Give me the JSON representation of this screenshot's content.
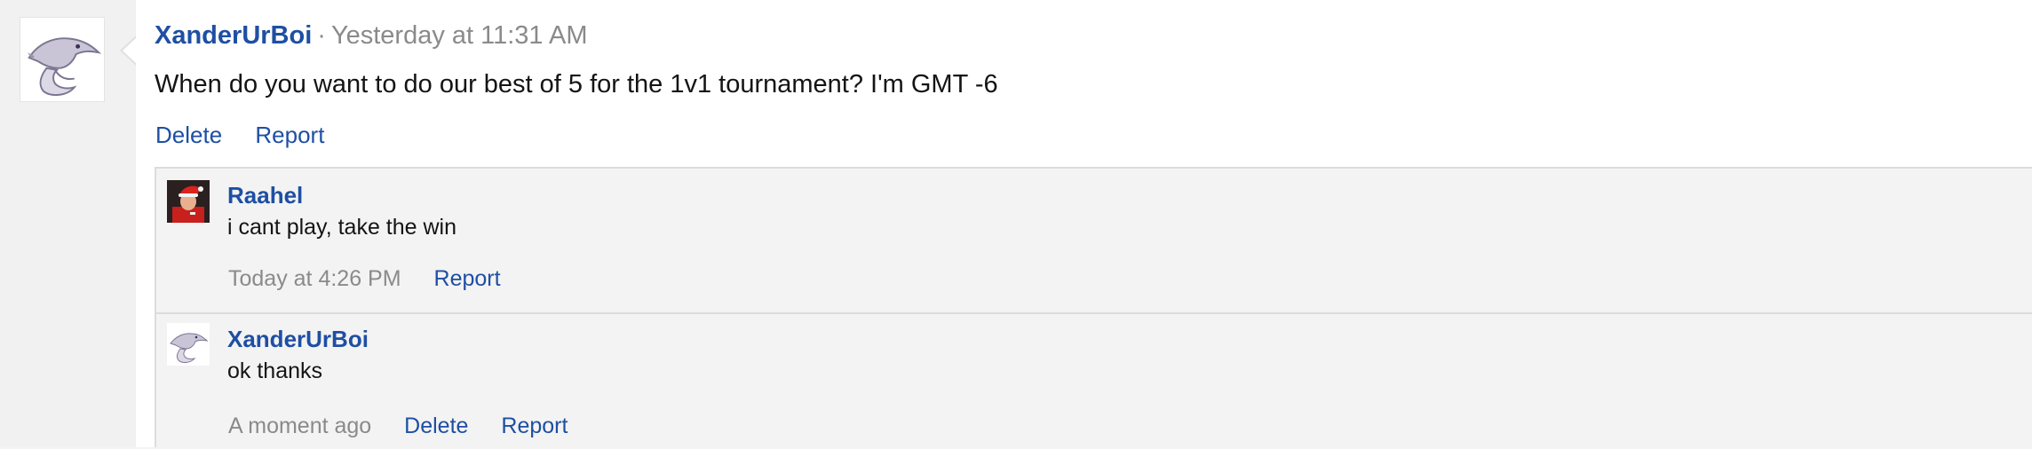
{
  "post": {
    "author": "XanderUrBoi",
    "separator": "·",
    "timestamp": "Yesterday at 11:31 AM",
    "body": "When do you want to do our best of 5 for the 1v1 tournament? I'm GMT -6",
    "actions": {
      "delete": "Delete",
      "report": "Report"
    },
    "avatar_icon": "pokemon-avatar-icon"
  },
  "comments": [
    {
      "author": "Raahel",
      "text": "i cant play, take the win",
      "time": "Today at 4:26 PM",
      "report": "Report",
      "avatar_icon": "santa-hat-avatar-icon"
    },
    {
      "author": "XanderUrBoi",
      "text": "ok thanks",
      "time": "A moment ago",
      "delete": "Delete",
      "report": "Report",
      "avatar_icon": "pokemon-avatar-icon"
    }
  ],
  "colors": {
    "link": "#1e4fa3",
    "muted": "#8a8a8a",
    "text": "#141414",
    "comment_bg": "#f3f3f3"
  }
}
